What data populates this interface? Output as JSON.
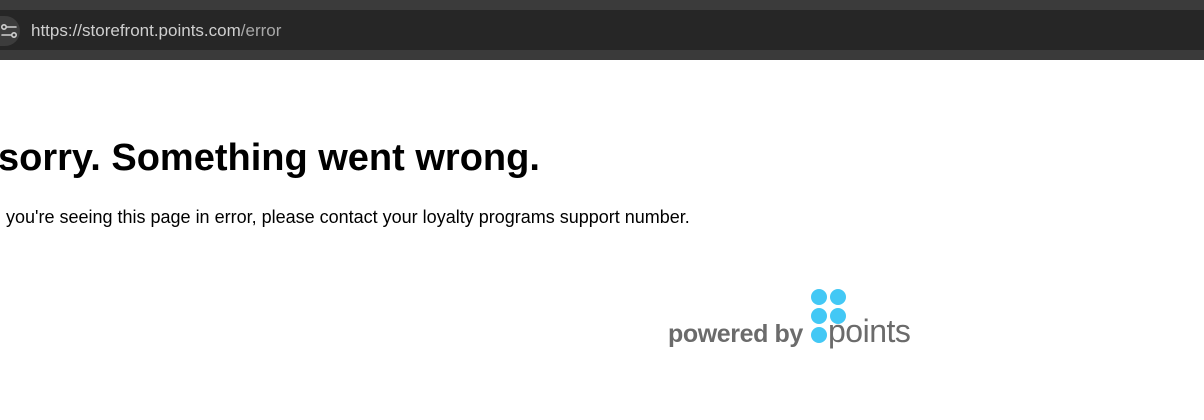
{
  "browser": {
    "url": {
      "base": "https://storefront.points.com",
      "path": "/error"
    },
    "site_settings_icon": "site-settings-icon"
  },
  "page": {
    "title": "sorry. Something went wrong.",
    "message": "you're seeing this page in error, please contact your loyalty programs support number."
  },
  "branding": {
    "powered_by": "powered by",
    "brand": "points",
    "brand_color": "#43c8f5",
    "text_color": "#6b6b6b"
  }
}
